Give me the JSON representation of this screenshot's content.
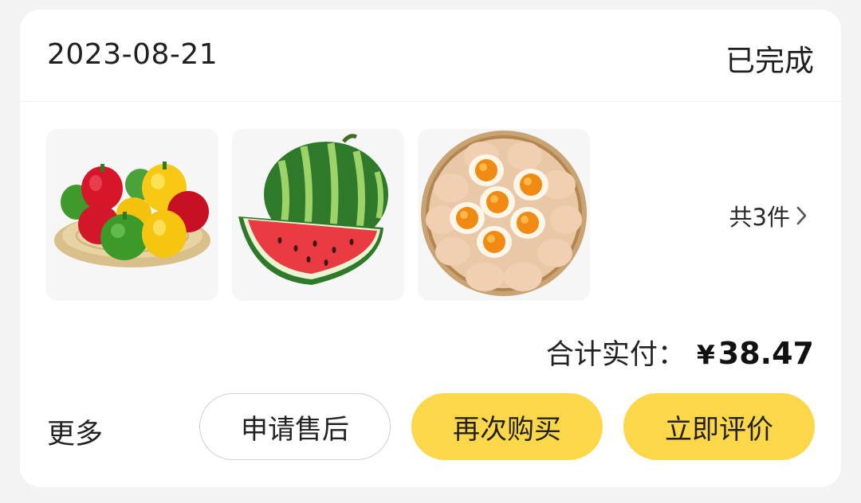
{
  "order": {
    "date": "2023-08-21",
    "status": "已完成"
  },
  "products": {
    "items": [
      {
        "icon": "bell-peppers-image"
      },
      {
        "icon": "watermelon-image"
      },
      {
        "icon": "eggs-basket-image"
      }
    ],
    "count_label": "共3件"
  },
  "total": {
    "label": "合计实付：",
    "currency": "¥",
    "amount": "38.47"
  },
  "actions": {
    "more": "更多",
    "after_sales": "申请售后",
    "rebuy": "再次购买",
    "review": "立即评价"
  },
  "colors": {
    "accent_yellow": "#fdd74a",
    "background": "#f3f3f3",
    "card": "#ffffff"
  }
}
